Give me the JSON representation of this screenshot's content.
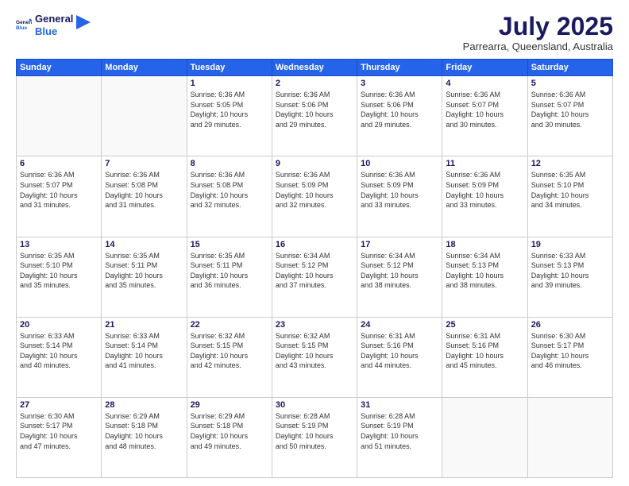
{
  "logo": {
    "line1": "General",
    "line2": "Blue"
  },
  "title": "July 2025",
  "subtitle": "Parrearra, Queensland, Australia",
  "weekdays": [
    "Sunday",
    "Monday",
    "Tuesday",
    "Wednesday",
    "Thursday",
    "Friday",
    "Saturday"
  ],
  "weeks": [
    [
      {
        "day": "",
        "info": ""
      },
      {
        "day": "",
        "info": ""
      },
      {
        "day": "1",
        "info": "Sunrise: 6:36 AM\nSunset: 5:05 PM\nDaylight: 10 hours\nand 29 minutes."
      },
      {
        "day": "2",
        "info": "Sunrise: 6:36 AM\nSunset: 5:06 PM\nDaylight: 10 hours\nand 29 minutes."
      },
      {
        "day": "3",
        "info": "Sunrise: 6:36 AM\nSunset: 5:06 PM\nDaylight: 10 hours\nand 29 minutes."
      },
      {
        "day": "4",
        "info": "Sunrise: 6:36 AM\nSunset: 5:07 PM\nDaylight: 10 hours\nand 30 minutes."
      },
      {
        "day": "5",
        "info": "Sunrise: 6:36 AM\nSunset: 5:07 PM\nDaylight: 10 hours\nand 30 minutes."
      }
    ],
    [
      {
        "day": "6",
        "info": "Sunrise: 6:36 AM\nSunset: 5:07 PM\nDaylight: 10 hours\nand 31 minutes."
      },
      {
        "day": "7",
        "info": "Sunrise: 6:36 AM\nSunset: 5:08 PM\nDaylight: 10 hours\nand 31 minutes."
      },
      {
        "day": "8",
        "info": "Sunrise: 6:36 AM\nSunset: 5:08 PM\nDaylight: 10 hours\nand 32 minutes."
      },
      {
        "day": "9",
        "info": "Sunrise: 6:36 AM\nSunset: 5:09 PM\nDaylight: 10 hours\nand 32 minutes."
      },
      {
        "day": "10",
        "info": "Sunrise: 6:36 AM\nSunset: 5:09 PM\nDaylight: 10 hours\nand 33 minutes."
      },
      {
        "day": "11",
        "info": "Sunrise: 6:36 AM\nSunset: 5:09 PM\nDaylight: 10 hours\nand 33 minutes."
      },
      {
        "day": "12",
        "info": "Sunrise: 6:35 AM\nSunset: 5:10 PM\nDaylight: 10 hours\nand 34 minutes."
      }
    ],
    [
      {
        "day": "13",
        "info": "Sunrise: 6:35 AM\nSunset: 5:10 PM\nDaylight: 10 hours\nand 35 minutes."
      },
      {
        "day": "14",
        "info": "Sunrise: 6:35 AM\nSunset: 5:11 PM\nDaylight: 10 hours\nand 35 minutes."
      },
      {
        "day": "15",
        "info": "Sunrise: 6:35 AM\nSunset: 5:11 PM\nDaylight: 10 hours\nand 36 minutes."
      },
      {
        "day": "16",
        "info": "Sunrise: 6:34 AM\nSunset: 5:12 PM\nDaylight: 10 hours\nand 37 minutes."
      },
      {
        "day": "17",
        "info": "Sunrise: 6:34 AM\nSunset: 5:12 PM\nDaylight: 10 hours\nand 38 minutes."
      },
      {
        "day": "18",
        "info": "Sunrise: 6:34 AM\nSunset: 5:13 PM\nDaylight: 10 hours\nand 38 minutes."
      },
      {
        "day": "19",
        "info": "Sunrise: 6:33 AM\nSunset: 5:13 PM\nDaylight: 10 hours\nand 39 minutes."
      }
    ],
    [
      {
        "day": "20",
        "info": "Sunrise: 6:33 AM\nSunset: 5:14 PM\nDaylight: 10 hours\nand 40 minutes."
      },
      {
        "day": "21",
        "info": "Sunrise: 6:33 AM\nSunset: 5:14 PM\nDaylight: 10 hours\nand 41 minutes."
      },
      {
        "day": "22",
        "info": "Sunrise: 6:32 AM\nSunset: 5:15 PM\nDaylight: 10 hours\nand 42 minutes."
      },
      {
        "day": "23",
        "info": "Sunrise: 6:32 AM\nSunset: 5:15 PM\nDaylight: 10 hours\nand 43 minutes."
      },
      {
        "day": "24",
        "info": "Sunrise: 6:31 AM\nSunset: 5:16 PM\nDaylight: 10 hours\nand 44 minutes."
      },
      {
        "day": "25",
        "info": "Sunrise: 6:31 AM\nSunset: 5:16 PM\nDaylight: 10 hours\nand 45 minutes."
      },
      {
        "day": "26",
        "info": "Sunrise: 6:30 AM\nSunset: 5:17 PM\nDaylight: 10 hours\nand 46 minutes."
      }
    ],
    [
      {
        "day": "27",
        "info": "Sunrise: 6:30 AM\nSunset: 5:17 PM\nDaylight: 10 hours\nand 47 minutes."
      },
      {
        "day": "28",
        "info": "Sunrise: 6:29 AM\nSunset: 5:18 PM\nDaylight: 10 hours\nand 48 minutes."
      },
      {
        "day": "29",
        "info": "Sunrise: 6:29 AM\nSunset: 5:18 PM\nDaylight: 10 hours\nand 49 minutes."
      },
      {
        "day": "30",
        "info": "Sunrise: 6:28 AM\nSunset: 5:19 PM\nDaylight: 10 hours\nand 50 minutes."
      },
      {
        "day": "31",
        "info": "Sunrise: 6:28 AM\nSunset: 5:19 PM\nDaylight: 10 hours\nand 51 minutes."
      },
      {
        "day": "",
        "info": ""
      },
      {
        "day": "",
        "info": ""
      }
    ]
  ]
}
